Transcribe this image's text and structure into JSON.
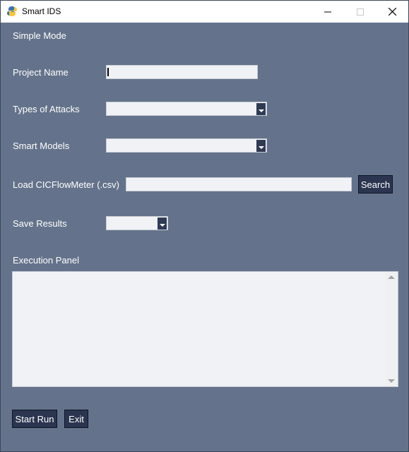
{
  "window": {
    "title": "Smart IDS"
  },
  "labels": {
    "mode": "Simple Mode",
    "project_name": "Project Name",
    "types_of_attacks": "Types of Attacks",
    "smart_models": "Smart Models",
    "load_csv": "Load CICFlowMeter (.csv)",
    "save_results": "Save Results",
    "execution_panel": "Execution Panel"
  },
  "inputs": {
    "project_name": "",
    "types_of_attacks": "",
    "smart_models": "",
    "csv_path": "",
    "save_results": ""
  },
  "buttons": {
    "search": "Search",
    "start_run": "Start Run",
    "exit": "Exit"
  },
  "icons": {
    "app": "python-feather-icon",
    "minimize": "minimize-icon",
    "maximize": "maximize-icon",
    "close": "close-icon"
  },
  "colors": {
    "background": "#64738b",
    "button": "#2b3550",
    "entry": "#f0f2f6"
  }
}
